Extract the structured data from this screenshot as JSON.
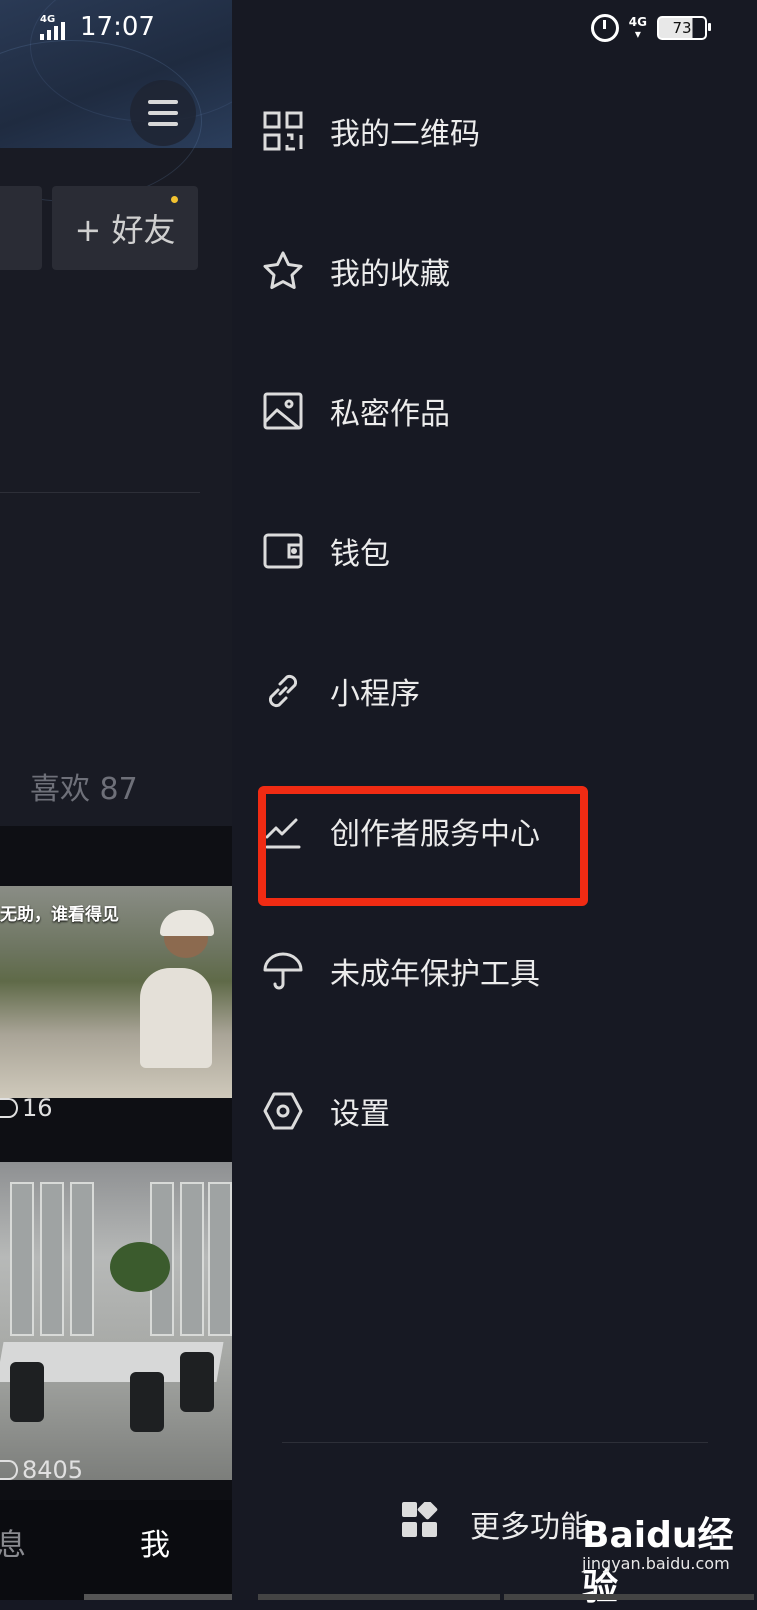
{
  "status_bar": {
    "time": "17:07",
    "network_left": "4G",
    "network_right": "4G",
    "battery": "73"
  },
  "profile_background": {
    "add_friend_label": "+ 好友",
    "likes_label": "喜欢 87",
    "video1": {
      "caption": "无助，谁看得见",
      "views": "16"
    },
    "video2": {
      "views": "8405"
    },
    "tabbar": {
      "messages_label": "息",
      "me_label": "我"
    }
  },
  "drawer": {
    "items": [
      {
        "label": "我的二维码",
        "icon": "qrcode-icon"
      },
      {
        "label": "我的收藏",
        "icon": "star-icon"
      },
      {
        "label": "私密作品",
        "icon": "image-icon"
      },
      {
        "label": "钱包",
        "icon": "wallet-icon"
      },
      {
        "label": "小程序",
        "icon": "link-icon"
      },
      {
        "label": "创作者服务中心",
        "icon": "chart-icon"
      },
      {
        "label": "未成年保护工具",
        "icon": "umbrella-icon"
      },
      {
        "label": "设置",
        "icon": "hexagon-settings-icon"
      }
    ],
    "more_label": "更多功能",
    "highlight_color": "#f02b13"
  },
  "watermark": {
    "brand": "Baidu经验",
    "url": "jingyan.baidu.com"
  }
}
